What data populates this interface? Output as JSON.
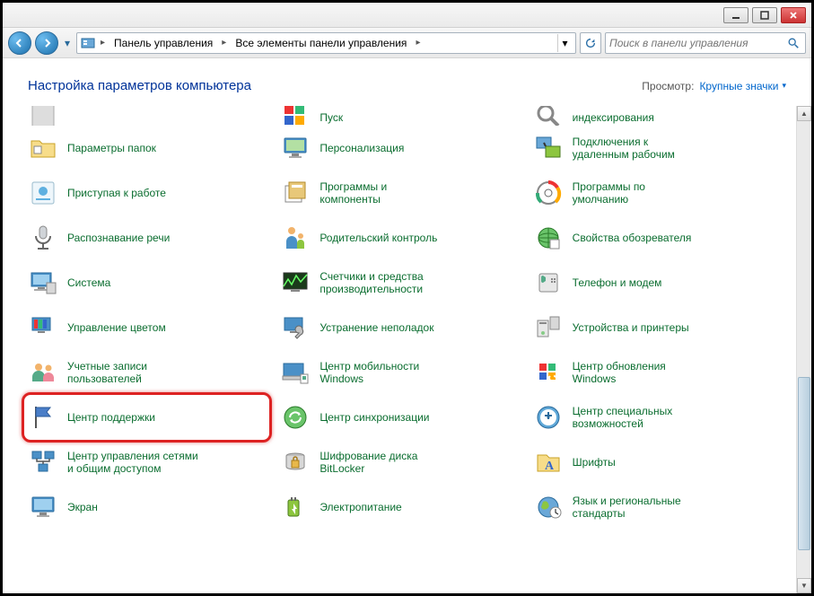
{
  "breadcrumbs": [
    "Панель управления",
    "Все элементы панели управления"
  ],
  "search_placeholder": "Поиск в панели управления",
  "heading": "Настройка параметров компьютера",
  "view_label": "Просмотр:",
  "view_mode": "Крупные значки",
  "items_truncated": [
    {
      "label": "",
      "icon": "generic"
    },
    {
      "label": "Пуск",
      "icon": "start"
    },
    {
      "label": "индексирования",
      "icon": "index"
    }
  ],
  "items": [
    {
      "label": "Параметры папок",
      "icon": "folder"
    },
    {
      "label": "Персонализация",
      "icon": "monitor"
    },
    {
      "label": "Подключения к\nудаленным рабочим",
      "icon": "remote"
    },
    {
      "label": "Приступая к работе",
      "icon": "getstarted"
    },
    {
      "label": "Программы и\nкомпоненты",
      "icon": "programs"
    },
    {
      "label": "Программы по\nумолчанию",
      "icon": "defaults"
    },
    {
      "label": "Распознавание речи",
      "icon": "mic"
    },
    {
      "label": "Родительский контроль",
      "icon": "parental"
    },
    {
      "label": "Свойства обозревателя",
      "icon": "internet"
    },
    {
      "label": "Система",
      "icon": "system"
    },
    {
      "label": "Счетчики и средства\nпроизводительности",
      "icon": "perf"
    },
    {
      "label": "Телефон и модем",
      "icon": "phone"
    },
    {
      "label": "Управление цветом",
      "icon": "color"
    },
    {
      "label": "Устранение неполадок",
      "icon": "troubleshoot"
    },
    {
      "label": "Устройства и принтеры",
      "icon": "devices"
    },
    {
      "label": "Учетные записи\nпользователей",
      "icon": "users"
    },
    {
      "label": "Центр мобильности\nWindows",
      "icon": "mobility"
    },
    {
      "label": "Центр обновления\nWindows",
      "icon": "update"
    },
    {
      "label": "Центр поддержки",
      "icon": "flag",
      "highlight": true
    },
    {
      "label": "Центр синхронизации",
      "icon": "sync"
    },
    {
      "label": "Центр специальных\nвозможностей",
      "icon": "ease"
    },
    {
      "label": "Центр управления сетями\nи общим доступом",
      "icon": "network"
    },
    {
      "label": "Шифрование диска\nBitLocker",
      "icon": "bitlocker"
    },
    {
      "label": "Шрифты",
      "icon": "fonts"
    },
    {
      "label": "Экран",
      "icon": "display"
    },
    {
      "label": "Электропитание",
      "icon": "power"
    },
    {
      "label": "Язык и региональные\nстандарты",
      "icon": "region"
    }
  ]
}
